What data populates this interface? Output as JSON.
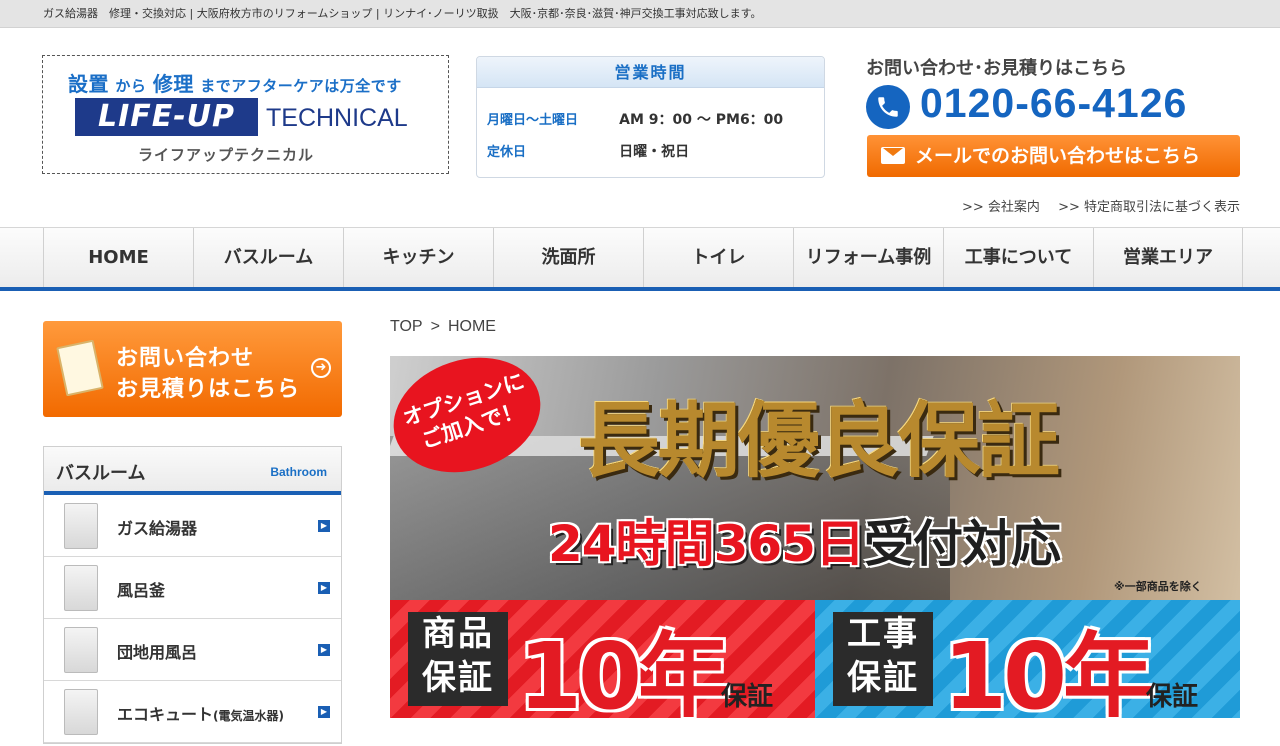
{
  "topbar": {
    "text": "ガス給湯器　修理・交換対応 | 大阪府枚方市のリフォームショップ | リンナイ･ノーリツ取扱　大阪･京都･奈良･滋賀･神戸交換工事対応致します。"
  },
  "logo": {
    "tagline_a": "設置",
    "tagline_b": "から",
    "tagline_c": "修理",
    "tagline_d": "までアフターケアは万全です",
    "main": "LIFE-UP",
    "sub": "TECHNICAL",
    "kana": "ライフアップテクニカル"
  },
  "hours": {
    "title": "営業時間",
    "rows": [
      {
        "label": "月曜日〜土曜日",
        "value": "AM 9：00 〜 PM6：00"
      },
      {
        "label": "定休日",
        "value": "日曜・祝日"
      }
    ]
  },
  "contact": {
    "label": "お問い合わせ･お見積りはこちら",
    "phone": "0120-66-4126",
    "mail_button": "メールでのお問い合わせはこちら"
  },
  "util_links": [
    ">> 会社案内",
    ">> 特定商取引法に基づく表示"
  ],
  "nav": [
    "HOME",
    "バスルーム",
    "キッチン",
    "洗面所",
    "トイレ",
    "リフォーム事例",
    "工事について",
    "営業エリア"
  ],
  "sidebar": {
    "cta_line1": "お問い合わせ",
    "cta_line2": "お見積りはこちら",
    "bath_title": "バスルーム",
    "bath_en": "Bathroom",
    "items": [
      {
        "label": "ガス給湯器",
        "small": ""
      },
      {
        "label": "風呂釜",
        "small": ""
      },
      {
        "label": "団地用風呂",
        "small": ""
      },
      {
        "label": "エコキュート",
        "small": "(電気温水器)"
      }
    ]
  },
  "breadcrumb": {
    "top": "TOP",
    "sep": ">",
    "current": "HOME"
  },
  "banner": {
    "badge_line1": "オプションに",
    "badge_line2": "ご加入で！",
    "headline": "長期優良保証",
    "sub_red": "24時間365日",
    "sub_dark": "受付対応",
    "note": "※一部商品を除く",
    "left_label_1": "商品",
    "left_label_2": "保証",
    "left_big": "10年",
    "left_small": "保証",
    "right_label_1": "工事",
    "right_label_2": "保証",
    "right_big": "10年",
    "right_small": "保証"
  }
}
